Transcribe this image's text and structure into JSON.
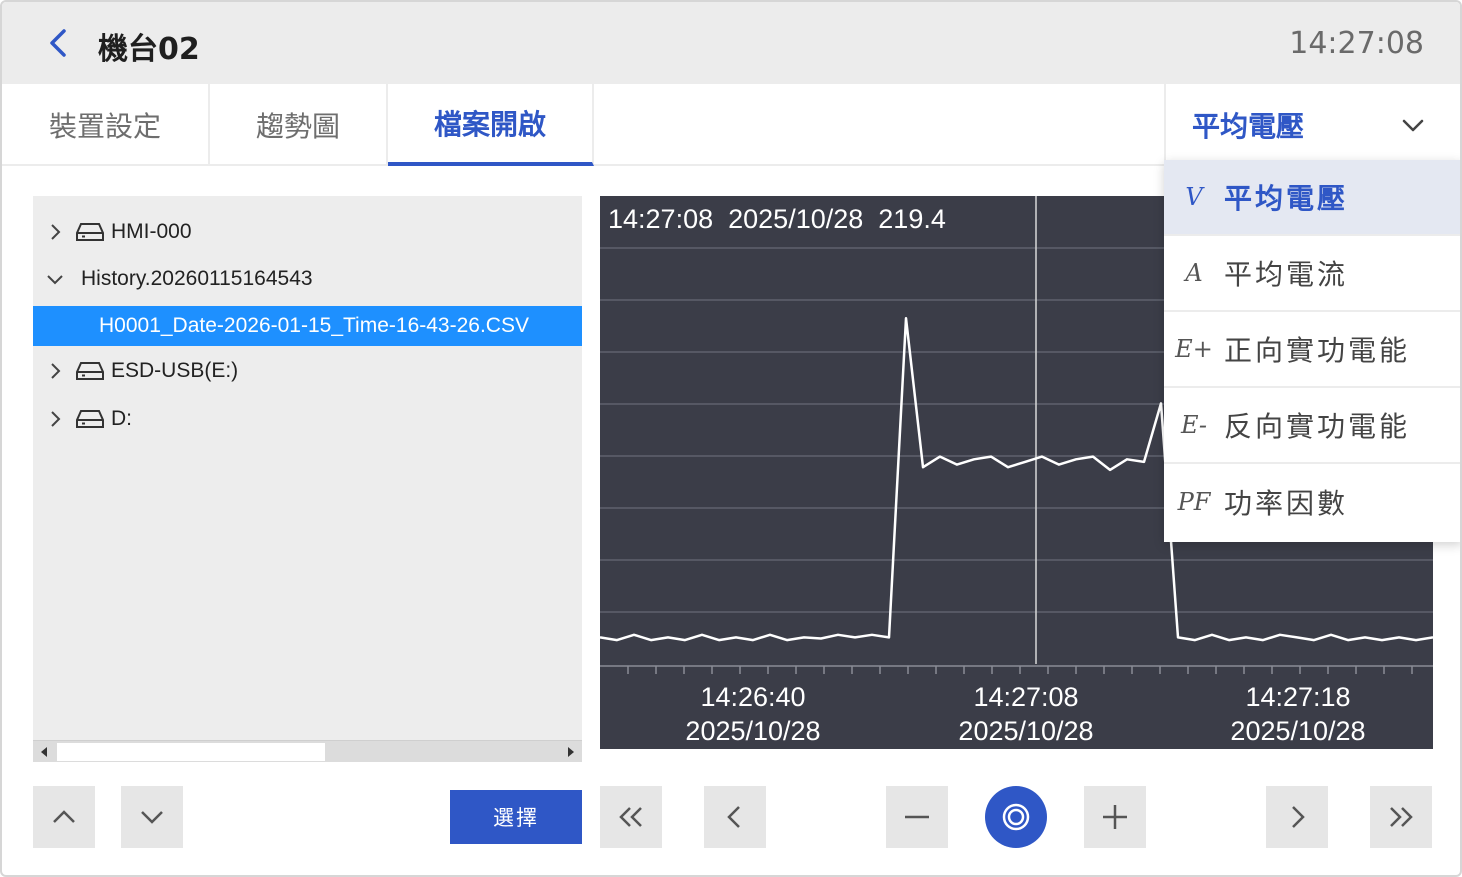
{
  "header": {
    "title": "機台02",
    "clock": "14:27:08"
  },
  "tabs": [
    {
      "label": "裝置設定",
      "active": false
    },
    {
      "label": "趨勢圖",
      "active": false
    },
    {
      "label": "檔案開啟",
      "active": true
    }
  ],
  "selector": {
    "current": "平均電壓"
  },
  "dropdown": {
    "items": [
      {
        "symbol": "V",
        "label": "平均電壓",
        "selected": true
      },
      {
        "symbol": "A",
        "label": "平均電流",
        "selected": false
      },
      {
        "symbol": "E+",
        "label": "正向實功電能",
        "selected": false
      },
      {
        "symbol": "E-",
        "label": "反向實功電能",
        "selected": false
      },
      {
        "symbol": "PF",
        "label": "功率因數",
        "selected": false
      }
    ]
  },
  "file_tree": {
    "items": [
      {
        "label": "HMI-000",
        "kind": "drive",
        "expanded": false
      },
      {
        "label": "History.20260115164543",
        "kind": "folder",
        "expanded": true
      },
      {
        "label": "H0001_Date-2026-01-15_Time-16-43-26.CSV",
        "kind": "file",
        "selected": true
      },
      {
        "label": "ESD-USB(E:)",
        "kind": "drive",
        "expanded": false
      },
      {
        "label": "D:",
        "kind": "drive",
        "expanded": false
      }
    ]
  },
  "buttons": {
    "select_label": "選擇"
  },
  "chart_readout": {
    "time": "14:27:08",
    "date": "2025/10/28",
    "value": "219.4"
  },
  "chart_data": {
    "type": "line",
    "title": "",
    "xlabel": "",
    "ylabel": "",
    "x_ticks": [
      {
        "time": "14:26:40",
        "date": "2025/10/28"
      },
      {
        "time": "14:27:08",
        "date": "2025/10/28"
      },
      {
        "time": "14:27:18",
        "date": "2025/10/28"
      }
    ],
    "cursor_time": "14:27:08",
    "grid": true,
    "line_color": "#ffffff",
    "background": "#3b3d48",
    "ylim": [
      0,
      8.8
    ],
    "series": [
      {
        "values": [
          0.5,
          0.45,
          0.55,
          0.45,
          0.5,
          0.45,
          0.55,
          0.45,
          0.5,
          0.45,
          0.55,
          0.45,
          0.5,
          0.48,
          0.55,
          0.5,
          0.55,
          0.5,
          6.5,
          3.7,
          3.9,
          3.75,
          3.85,
          3.9,
          3.7,
          3.8,
          3.9,
          3.75,
          3.85,
          3.9,
          3.65,
          3.85,
          3.8,
          4.9,
          0.5,
          0.45,
          0.55,
          0.45,
          0.5,
          0.45,
          0.55,
          0.5,
          0.45,
          0.55,
          0.45,
          0.5,
          0.45,
          0.5,
          0.45,
          0.5
        ]
      }
    ]
  },
  "colors": {
    "accent": "#2f57c6",
    "selection": "#1e90ff",
    "chart_bg": "#3b3d48"
  }
}
